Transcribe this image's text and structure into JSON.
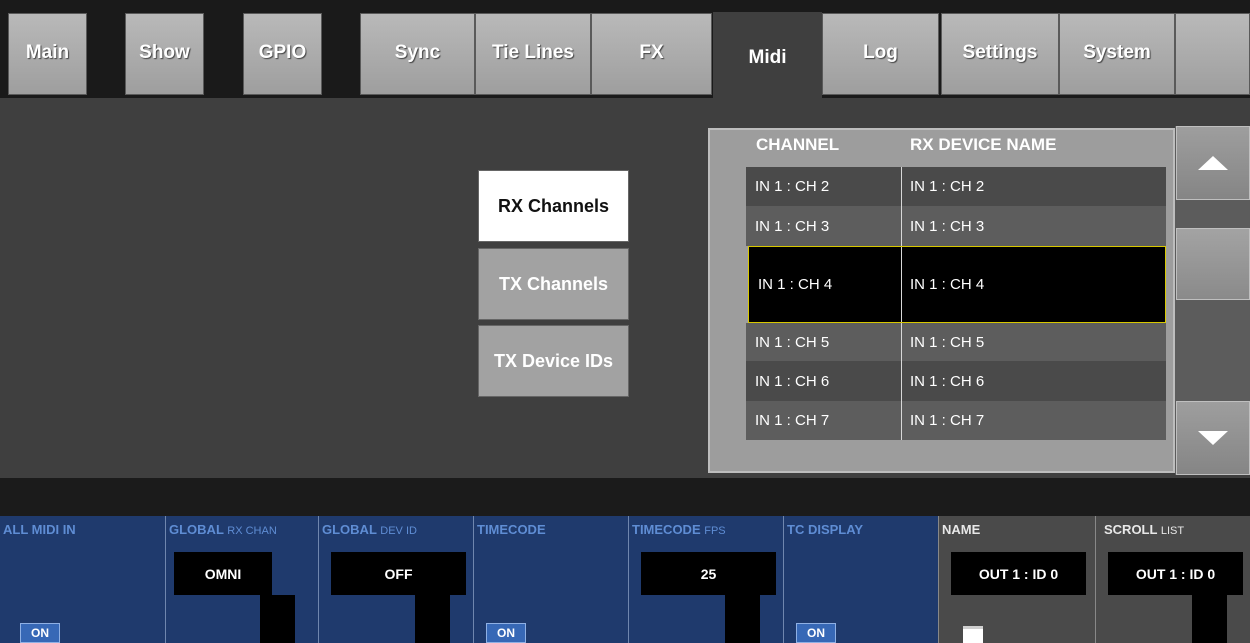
{
  "tabs": [
    {
      "label": "Main",
      "active": false
    },
    {
      "label": "Show",
      "active": false
    },
    {
      "label": "GPIO",
      "active": false
    },
    {
      "label": "Sync",
      "active": false
    },
    {
      "label": "Tie Lines",
      "active": false
    },
    {
      "label": "FX",
      "active": false
    },
    {
      "label": "Midi",
      "active": true
    },
    {
      "label": "Log",
      "active": false
    },
    {
      "label": "Settings",
      "active": false
    },
    {
      "label": "System",
      "active": false
    }
  ],
  "side_buttons": [
    {
      "label": "RX Channels",
      "active": true
    },
    {
      "label": "TX Channels",
      "active": false
    },
    {
      "label": "TX Device IDs",
      "active": false
    }
  ],
  "table": {
    "headers": [
      "CHANNEL",
      "RX DEVICE NAME"
    ],
    "rows": [
      {
        "channel": "IN 1 : CH 2",
        "name": "IN 1 : CH 2",
        "selected": false
      },
      {
        "channel": "IN 1 : CH 3",
        "name": "IN 1 : CH 3",
        "selected": false
      },
      {
        "channel": "IN 1 : CH 4",
        "name": "IN 1 : CH 4",
        "selected": true
      },
      {
        "channel": "IN 1 : CH 5",
        "name": "IN 1 : CH 5",
        "selected": false
      },
      {
        "channel": "IN 1 : CH 6",
        "name": "IN 1 : CH 6",
        "selected": false
      },
      {
        "channel": "IN 1 : CH 7",
        "name": "IN 1 : CH 7",
        "selected": false
      }
    ]
  },
  "bottom": {
    "all_midi_in": {
      "label": "ALL MIDI IN",
      "on": "ON"
    },
    "global_rx_chan": {
      "label": "GLOBAL",
      "sub": "RX CHAN",
      "value": "OMNI"
    },
    "global_dev_id": {
      "label": "GLOBAL",
      "sub": "DEV ID",
      "value": "OFF"
    },
    "timecode": {
      "label": "TIMECODE",
      "on": "ON"
    },
    "timecode_fps": {
      "label": "TIMECODE",
      "sub": "FPS",
      "value": "25"
    },
    "tc_display": {
      "label": "TC DISPLAY",
      "on": "ON"
    },
    "name": {
      "label": "NAME",
      "value": "OUT 1 : ID 0"
    },
    "scroll_list": {
      "label": "SCROLL",
      "sub": "LIST",
      "value": "OUT 1 : ID 0"
    }
  },
  "colors": {
    "accent_blue": "#1f3a6d",
    "label_blue": "#5f8dd4",
    "selection_outline": "#d8c800"
  }
}
